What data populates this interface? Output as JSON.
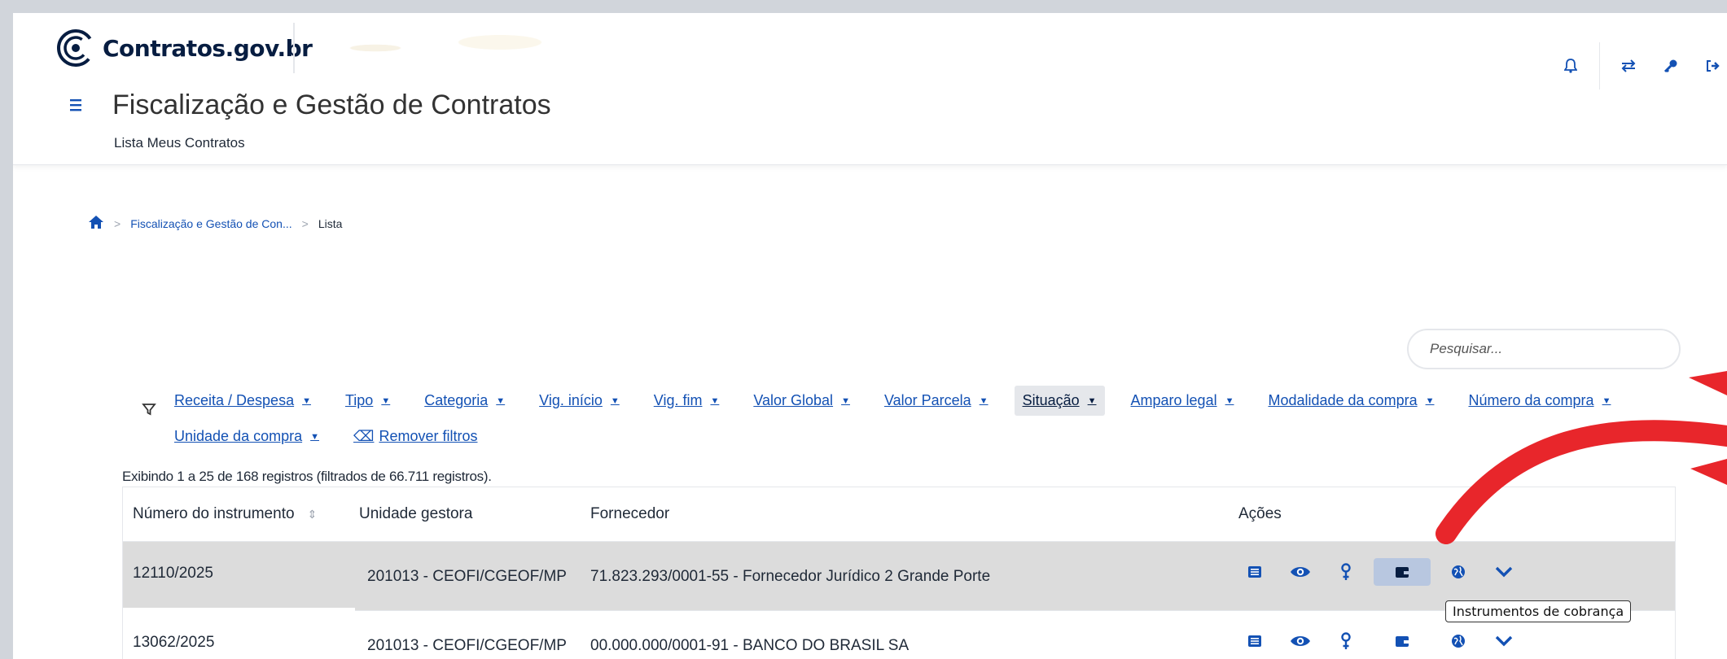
{
  "header": {
    "logo_text": "Contratos.gov.br",
    "icons": [
      "bell-icon",
      "transfer-icon",
      "key-icon",
      "logout-icon"
    ]
  },
  "page": {
    "title": "Fiscalização e Gestão de Contratos",
    "subtitle": "Lista Meus Contratos"
  },
  "breadcrumb": {
    "home_icon": "home-icon",
    "items": [
      "Fiscalização e Gestão de Con...",
      "Lista"
    ]
  },
  "search": {
    "placeholder": "Pesquisar..."
  },
  "filters": {
    "row1": [
      "Receita / Despesa",
      "Tipo",
      "Categoria",
      "Vig. início",
      "Vig. fim",
      "Valor Global",
      "Valor Parcela",
      "Situação",
      "Amparo legal",
      "Modalidade da compra",
      "Número da compra"
    ],
    "row2": [
      "Unidade da compra"
    ],
    "active": "Situação",
    "remove_label": "Remover filtros"
  },
  "records_info": "Exibindo 1 a 25 de 168 registros (filtrados de 66.711 registros).",
  "table": {
    "headers": [
      "Número do instrumento",
      "Unidade gestora",
      "Fornecedor",
      "Ações"
    ],
    "rows": [
      {
        "numero": "12110/2025",
        "unidade": "201013 - CEOFI/CGEOF/MP",
        "fornecedor": "71.823.293/0001-55 - Fornecedor Jurídico 2 Grande Porte"
      },
      {
        "numero": "13062/2025",
        "unidade": "201013 - CEOFI/CGEOF/MP",
        "fornecedor": "00.000.000/0001-91 - BANCO DO BRASIL SA"
      }
    ],
    "action_icons": [
      "list-icon",
      "eye-icon",
      "marker-icon",
      "wallet-icon",
      "globe-icon",
      "chevron-down-icon"
    ]
  },
  "tooltip": "Instrumentos de cobrança",
  "colors": {
    "primary": "#1351b4",
    "annotation_red": "#e8262b",
    "row_highlight": "#dcdcdc"
  }
}
